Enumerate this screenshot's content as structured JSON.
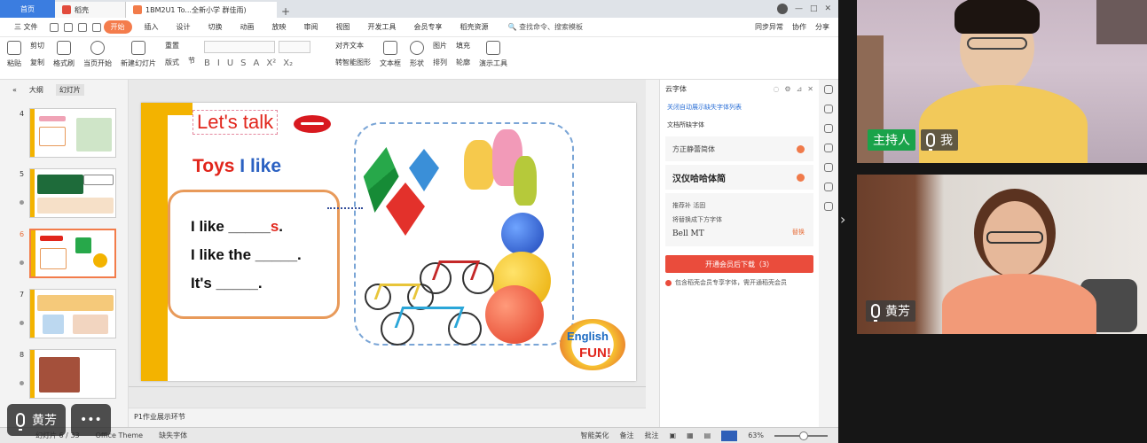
{
  "tabs": {
    "home": "首页",
    "doc": "稻壳",
    "active": "1BM2U1 To...全新小学 群佳雨)",
    "plus": "+",
    "right_items": [
      "分享"
    ]
  },
  "menubar": {
    "file": "三 文件",
    "start": "开始",
    "items": [
      "插入",
      "设计",
      "切换",
      "动画",
      "放映",
      "审阅",
      "视图",
      "开发工具",
      "会员专享",
      "稻壳资源"
    ],
    "search": "查找命令、搜索模板",
    "right_items": [
      "同步异常",
      "协作",
      "分享"
    ]
  },
  "ribbon": {
    "paste": "粘贴",
    "cut": "剪切",
    "copy": "复制",
    "format_painter": "格式刷",
    "from_current": "当页开始",
    "new_slide": "新建幻灯片",
    "layout": "版式",
    "section": "节",
    "reset": "重置",
    "text_box": "文本框",
    "shape": "形状",
    "arrange": "排列",
    "image": "图片",
    "fill": "填充",
    "outline": "轮廓",
    "demo_tools": "演示工具",
    "align_text": "对齐文本",
    "smart_shape": "转智能图形",
    "format_buttons": [
      "B",
      "I",
      "U",
      "S",
      "A",
      "X²",
      "X₂"
    ]
  },
  "leftpanel": {
    "outline_tab": "大纲",
    "slides_tab": "幻灯片",
    "slides": [
      {
        "num": "4",
        "active": false
      },
      {
        "num": "5",
        "active": false
      },
      {
        "num": "6",
        "active": true
      },
      {
        "num": "7",
        "active": false
      },
      {
        "num": "8",
        "active": false
      }
    ]
  },
  "slide": {
    "lets_talk": "Let's talk",
    "toys_red": "Toys ",
    "toys_blue": "I like",
    "line1_a": "I like _____",
    "line1_b": "s",
    "line1_c": ".",
    "line2": "I like the _____.",
    "line3": "It's _____.",
    "logo_top": "English",
    "logo_bottom": "FUN!"
  },
  "notes": {
    "text": "P1作业展示环节"
  },
  "rightpane": {
    "title": "云字体",
    "link": "关闭自动展示缺失字体列表",
    "section": "文档所缺字体",
    "font1": "方正静蕾简体",
    "font2": "汉仪哈哈体简",
    "box_line1": "推荐补 活固",
    "box_line2": "将替换成下方字体",
    "box_font": "Bell MT",
    "box_replace": "替换",
    "button": "开通会员后下载（3）",
    "note": "包含稻壳会员专享字体，需开通稻壳会员"
  },
  "status": {
    "slide": "幻灯片 6 / 33",
    "theme": "Office Theme",
    "missing_font": "缺失字体",
    "beautify": "智能美化",
    "notes_btn": "备注",
    "comments_btn": "批注",
    "zoom": "63%"
  },
  "overlay": {
    "speaker": "黄芳",
    "more": "•••"
  },
  "video": {
    "cam1_host": "主持人",
    "cam1_me": "我",
    "cam2_name": "黄芳"
  },
  "colors": {
    "accent": "#f47c4c",
    "slide_yellow": "#f3b300",
    "title_red": "#e1251b",
    "title_blue": "#2b61c2",
    "button_red": "#ea4c3c",
    "host_green": "#1aa34a"
  }
}
